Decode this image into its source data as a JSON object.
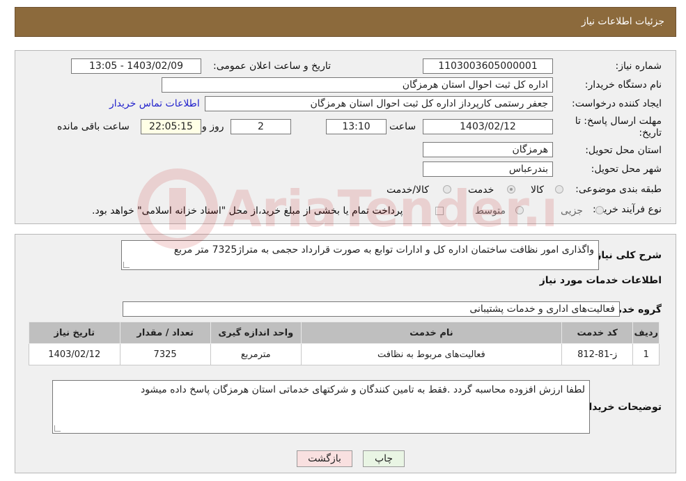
{
  "header": {
    "title": "جزئیات اطلاعات نیاز"
  },
  "details": {
    "need_number_label": "شماره نیاز:",
    "need_number": "1103003605000001",
    "announce_label": "تاریخ و ساعت اعلان عمومی:",
    "announce_value": "1403/02/09 - 13:05",
    "buyer_org_label": "نام دستگاه خریدار:",
    "buyer_org": "اداره کل ثبت احوال استان هرمزگان",
    "requester_label": "ایجاد کننده درخواست:",
    "requester": "جعفر رستمی کارپرداز اداره کل ثبت احوال استان هرمزگان",
    "contact_link": "اطلاعات تماس خریدار",
    "deadline_label_1": "مهلت ارسال پاسخ: تا",
    "deadline_label_2": "تاریخ:",
    "deadline_date": "1403/02/12",
    "time_label": "ساعت",
    "deadline_time": "13:10",
    "days_value": "2",
    "days_label": "روز و",
    "remaining_time": "22:05:15",
    "remaining_label": "ساعت باقی مانده",
    "province_label": "استان محل تحویل:",
    "province": "هرمزگان",
    "city_label": "شهر محل تحویل:",
    "city": "بندرعباس",
    "category_label": "طبقه بندی موضوعی:",
    "category_options": [
      "کالا",
      "خدمت",
      "کالا/خدمت"
    ],
    "category_selected": "خدمت",
    "process_label": "نوع فرآیند خرید :",
    "process_options": [
      "جزیی",
      "متوسط"
    ],
    "payment_note": "پرداخت تمام یا بخشی از مبلغ خرید،از محل \"اسناد خزانه اسلامی\" خواهد بود."
  },
  "summary": {
    "description_label": "شرح کلی نیاز:",
    "description": "واگذاری امور نظافت ساختمان اداره کل و ادارات توابع به صورت قرارداد حجمی به متراژ7325 متر مربع",
    "services_title": "اطلاعات خدمات مورد نیاز",
    "service_group_label": "گروه خدمت:",
    "service_group": "فعالیت‌های اداری و خدمات پشتیبانی",
    "table": {
      "headers": [
        "ردیف",
        "کد خدمت",
        "نام خدمت",
        "واحد اندازه گیری",
        "تعداد / مقدار",
        "تاریخ نیاز"
      ],
      "rows": [
        [
          "1",
          "ز-81-812",
          "فعالیت‌های مربوط به نظافت",
          "مترمربع",
          "7325",
          "1403/02/12"
        ]
      ]
    },
    "buyer_notes_label": "توضیحات خریدار:",
    "buyer_notes": "لطفا ارزش افزوده محاسبه گردد .فقط به تامین کنندگان و شرکتهای خدماتی استان هرمزگان پاسخ داده میشود"
  },
  "buttons": {
    "print": "چاپ",
    "back": "بازگشت"
  },
  "watermark": {
    "text": "AriaTender.neT"
  },
  "colors": {
    "header_bg": "#8c6a3c",
    "print_btn": "#e9f5e4",
    "back_btn": "#f9e0e0"
  }
}
